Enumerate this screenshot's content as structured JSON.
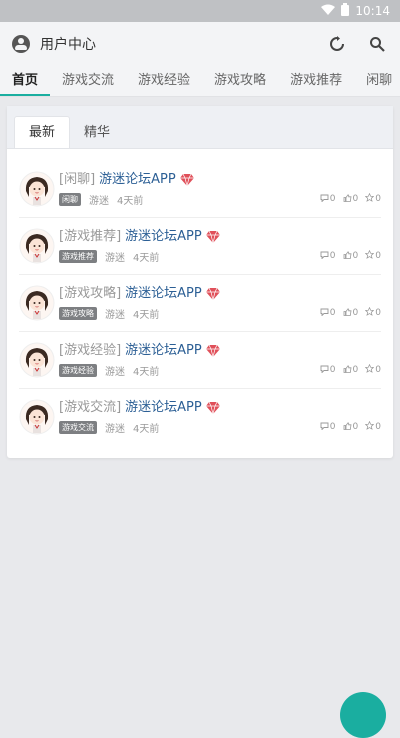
{
  "status_bar": {
    "time": "10:14"
  },
  "header": {
    "title": "用户中心"
  },
  "nav_tabs": [
    "首页",
    "游戏交流",
    "游戏经验",
    "游戏攻略",
    "游戏推荐",
    "闲聊"
  ],
  "card_tabs": [
    "最新",
    "精华"
  ],
  "posts": [
    {
      "category": "[闲聊]",
      "name": "游迷论坛APP",
      "badge": "闲聊",
      "author": "游迷",
      "time": "4天前",
      "comments": "0",
      "likes": "0",
      "stars": "0"
    },
    {
      "category": "[游戏推荐]",
      "name": "游迷论坛APP",
      "badge": "游戏推荐",
      "author": "游迷",
      "time": "4天前",
      "comments": "0",
      "likes": "0",
      "stars": "0"
    },
    {
      "category": "[游戏攻略]",
      "name": "游迷论坛APP",
      "badge": "游戏攻略",
      "author": "游迷",
      "time": "4天前",
      "comments": "0",
      "likes": "0",
      "stars": "0"
    },
    {
      "category": "[游戏经验]",
      "name": "游迷论坛APP",
      "badge": "游戏经验",
      "author": "游迷",
      "time": "4天前",
      "comments": "0",
      "likes": "0",
      "stars": "0"
    },
    {
      "category": "[游戏交流]",
      "name": "游迷论坛APP",
      "badge": "游戏交流",
      "author": "游迷",
      "time": "4天前",
      "comments": "0",
      "likes": "0",
      "stars": "0"
    }
  ],
  "colors": {
    "accent": "#1aaea0",
    "link": "#2c5f95",
    "gem": "#e0505a"
  },
  "icons": {
    "status": [
      "wifi-icon",
      "battery-icon"
    ],
    "header": [
      "user-icon",
      "refresh-icon",
      "search-icon"
    ],
    "post": [
      "gem-icon",
      "comment-icon",
      "like-icon",
      "star-icon"
    ]
  }
}
